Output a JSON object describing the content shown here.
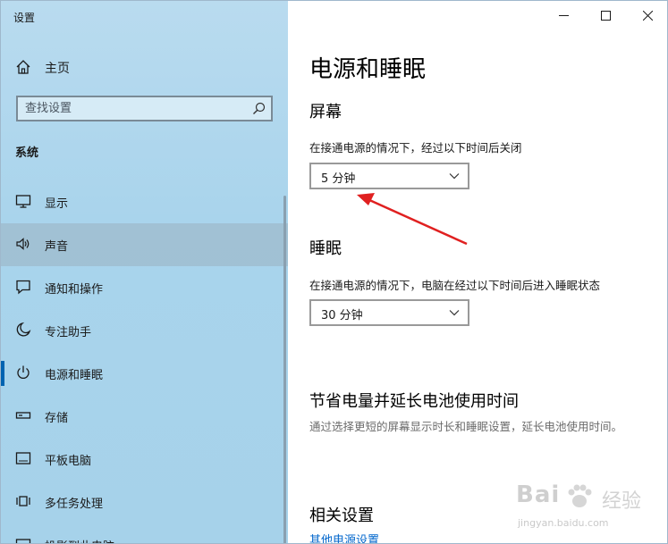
{
  "window": {
    "title": "设置"
  },
  "sidebar": {
    "home_label": "主页",
    "search_placeholder": "查找设置",
    "section": "系统",
    "items": [
      {
        "label": "显示",
        "icon": "monitor-icon"
      },
      {
        "label": "声音",
        "icon": "speaker-icon"
      },
      {
        "label": "通知和操作",
        "icon": "notification-icon"
      },
      {
        "label": "专注助手",
        "icon": "moon-icon"
      },
      {
        "label": "电源和睡眠",
        "icon": "power-icon"
      },
      {
        "label": "存储",
        "icon": "storage-icon"
      },
      {
        "label": "平板电脑",
        "icon": "tablet-icon"
      },
      {
        "label": "多任务处理",
        "icon": "multitask-icon"
      },
      {
        "label": "投影到此电脑",
        "icon": "projector-icon"
      }
    ]
  },
  "main": {
    "title": "电源和睡眠",
    "screen": {
      "heading": "屏幕",
      "desc": "在接通电源的情况下，经过以下时间后关闭",
      "value": "5 分钟"
    },
    "sleep": {
      "heading": "睡眠",
      "desc": "在接通电源的情况下，电脑在经过以下时间后进入睡眠状态",
      "value": "30 分钟"
    },
    "battery": {
      "heading": "节省电量并延长电池使用时间",
      "desc": "通过选择更短的屏幕显示时长和睡眠设置，延长电池使用时间。"
    },
    "related": {
      "heading": "相关设置",
      "link": "其他电源设置"
    }
  },
  "watermark": {
    "brand": "Bai",
    "jy": "经验",
    "url": "jingyan.baidu.com"
  },
  "colors": {
    "accent": "#0063b1",
    "arrow": "#e02020",
    "link": "#0066cc"
  }
}
